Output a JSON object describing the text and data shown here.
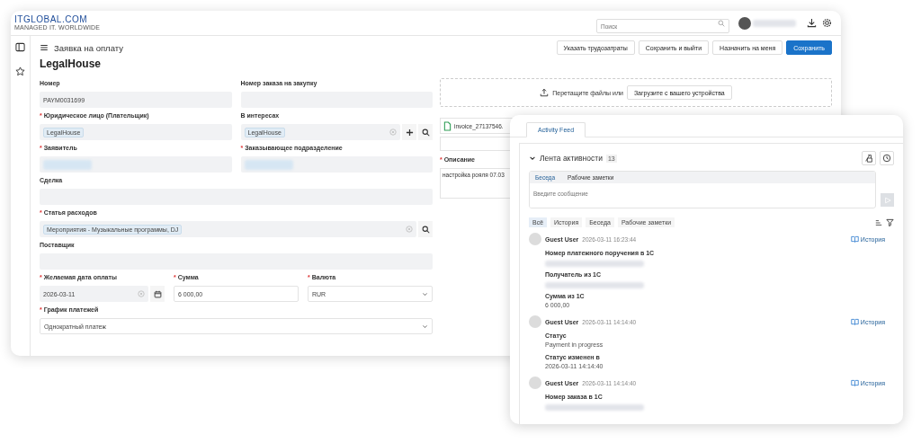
{
  "header": {
    "logo": "ITGLOBAL.COM",
    "tagline": "MANAGED IT. WORLDWIDE",
    "search": {
      "placeholder": "Поиск"
    }
  },
  "page": {
    "title": "Заявка на оплату",
    "record_title": "LegalHouse",
    "buttons": [
      {
        "label": "Указать трудозатраты",
        "kind": "secondary"
      },
      {
        "label": "Сохранить и выйти",
        "kind": "secondary"
      },
      {
        "label": "Назначить на меня",
        "kind": "secondary"
      },
      {
        "label": "Сохранить",
        "kind": "primary"
      }
    ]
  },
  "form": {
    "rows": [
      [
        {
          "label": "Номер",
          "kind": "readonly",
          "value": "PAYM0031699"
        },
        {
          "label": "Номер заказа на закупку",
          "kind": "readonly"
        }
      ],
      [
        {
          "label": "Юридическое лицо (Плательщик)",
          "required_mark": "*",
          "kind": "readonly",
          "value": "LegalHouse",
          "tag": true
        },
        {
          "label": "В интересах",
          "kind": "readonly",
          "value": "LegalHouse",
          "tag": true,
          "clearable": true,
          "can_add": true,
          "can_search": true
        }
      ],
      [
        {
          "label": "Заявитель",
          "required_mark": "*",
          "kind": "readonly",
          "redacted": true
        },
        {
          "label": "Заказывающее подразделение",
          "required_mark": "*",
          "kind": "readonly",
          "redacted": true
        }
      ],
      [
        {
          "label": "Сделка",
          "kind": "readonly"
        }
      ],
      [
        {
          "label": "Статья расходов",
          "required_mark": "*",
          "kind": "readonly",
          "value": "Мероприятия - Музыкальные программы, DJ",
          "tag": true,
          "clearable": true,
          "can_search": true
        }
      ],
      [
        {
          "label": "Поставщик",
          "kind": "readonly"
        }
      ],
      [
        {
          "label": "Желаемая дата оплаты",
          "required_mark": "*",
          "kind": "readonly",
          "value": "2026-03-11",
          "clearable": true,
          "calendar": true
        },
        {
          "label": "Сумма",
          "required_mark": "*",
          "kind": "input",
          "value": "6 000,00"
        },
        {
          "label": "Валюта",
          "required_mark": "*",
          "kind": "select",
          "value": "RUR"
        }
      ],
      [
        {
          "label": "График платежей",
          "required_mark": "*",
          "kind": "select",
          "value": "Однократный платеж"
        }
      ]
    ]
  },
  "attachments": {
    "drop_text": "Перетащите файлы или",
    "upload_button": "Загрузите с вашего устройства",
    "file": "invoice_27137546."
  },
  "description": {
    "label": "Описание",
    "required_mark": "*",
    "value": "настройка рояля 07.03"
  },
  "activity_panel": {
    "tabs": [
      {
        "label": "Activity Feed",
        "selected": true
      }
    ],
    "title": "Лента активности",
    "count": "13",
    "expanded": true,
    "composer": {
      "tabs": [
        {
          "label": "Беседа",
          "selected": true
        },
        {
          "label": "Рабочие заметки",
          "selected": false
        }
      ],
      "placeholder": "Введите сообщение",
      "send_disabled": true
    },
    "filters": [
      {
        "label": "Всё",
        "selected": true
      },
      {
        "label": "История",
        "selected": false
      },
      {
        "label": "Беседа",
        "selected": false
      },
      {
        "label": "Рабочие заметки",
        "selected": false
      }
    ],
    "entries": [
      {
        "author": "Guest User",
        "time": "2026-03-11 16:23:44",
        "link": "История",
        "changes": [
          {
            "label": "Номер платежного поручения в 1С",
            "redacted": true
          },
          {
            "label": "Получатель из 1С",
            "redacted": true
          },
          {
            "label": "Сумма из 1С",
            "value": "6 000,00"
          }
        ]
      },
      {
        "author": "Guest User",
        "time": "2026-03-11 14:14:40",
        "link": "История",
        "changes": [
          {
            "label": "Статус",
            "value": "Payment in progress"
          },
          {
            "label": "Статус изменен в",
            "value": "2026-03-11 14:14:40"
          }
        ]
      },
      {
        "author": "Guest User",
        "time": "2026-03-11 14:14:40",
        "link": "История",
        "changes": [
          {
            "label": "Номер заказа в 1С",
            "redacted": true
          }
        ]
      }
    ]
  }
}
